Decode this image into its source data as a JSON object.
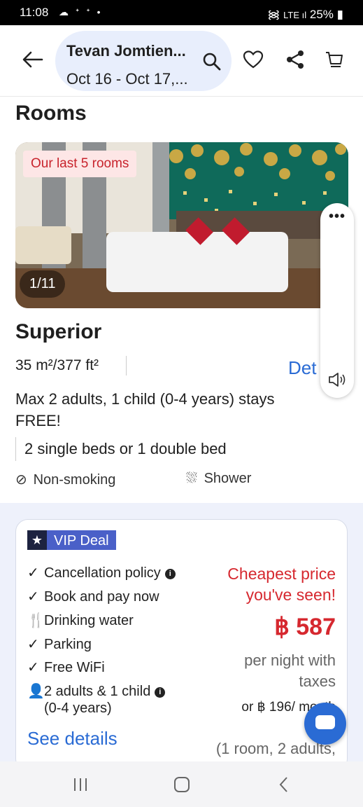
{
  "status_bar": {
    "time": "11:08",
    "left_icons": "☁ ᐩ ᐩ •",
    "battery": "25%"
  },
  "header": {
    "title": "Tevan Jomtien...",
    "dates": "Oct 16 - Oct 17,..."
  },
  "section_title": "Rooms",
  "photo": {
    "badge": "Our last 5 rooms",
    "counter": "1/11"
  },
  "room": {
    "name": "Superior",
    "area": "35 m²/377 ft²",
    "details_link": "Det",
    "occupancy": "Max 2 adults, 1 child (0-4 years) stays FREE!",
    "beds": "2 single beds or 1 double bed",
    "features": [
      {
        "icon": "no-smoking-icon",
        "label": "Non-smoking"
      },
      {
        "icon": "shower-icon",
        "label": "Shower"
      }
    ]
  },
  "deal": {
    "badge": "VIP Deal",
    "perks": [
      {
        "icon": "check-icon",
        "label": "Cancellation policy",
        "info": true
      },
      {
        "icon": "check-icon",
        "label": "Book and pay now",
        "info": false
      },
      {
        "icon": "utensils-icon",
        "label": "Drinking water",
        "info": false
      },
      {
        "icon": "check-icon",
        "label": "Parking",
        "info": false
      },
      {
        "icon": "check-icon",
        "label": "Free WiFi",
        "info": false
      },
      {
        "icon": "person-icon",
        "label": "2 adults & 1 child",
        "label2": "(0-4 years)",
        "info": true
      }
    ],
    "see_details": "See details",
    "cheapest": "Cheapest price you've seen!",
    "price": "฿ 587",
    "per_night": "per night with taxes",
    "monthly": "or ฿ 196/ month",
    "room_count": "(1 room, 2 adults,"
  },
  "colors": {
    "accent": "#2a6bd4",
    "price": "#d6282f",
    "vip": "#4a60c8"
  }
}
